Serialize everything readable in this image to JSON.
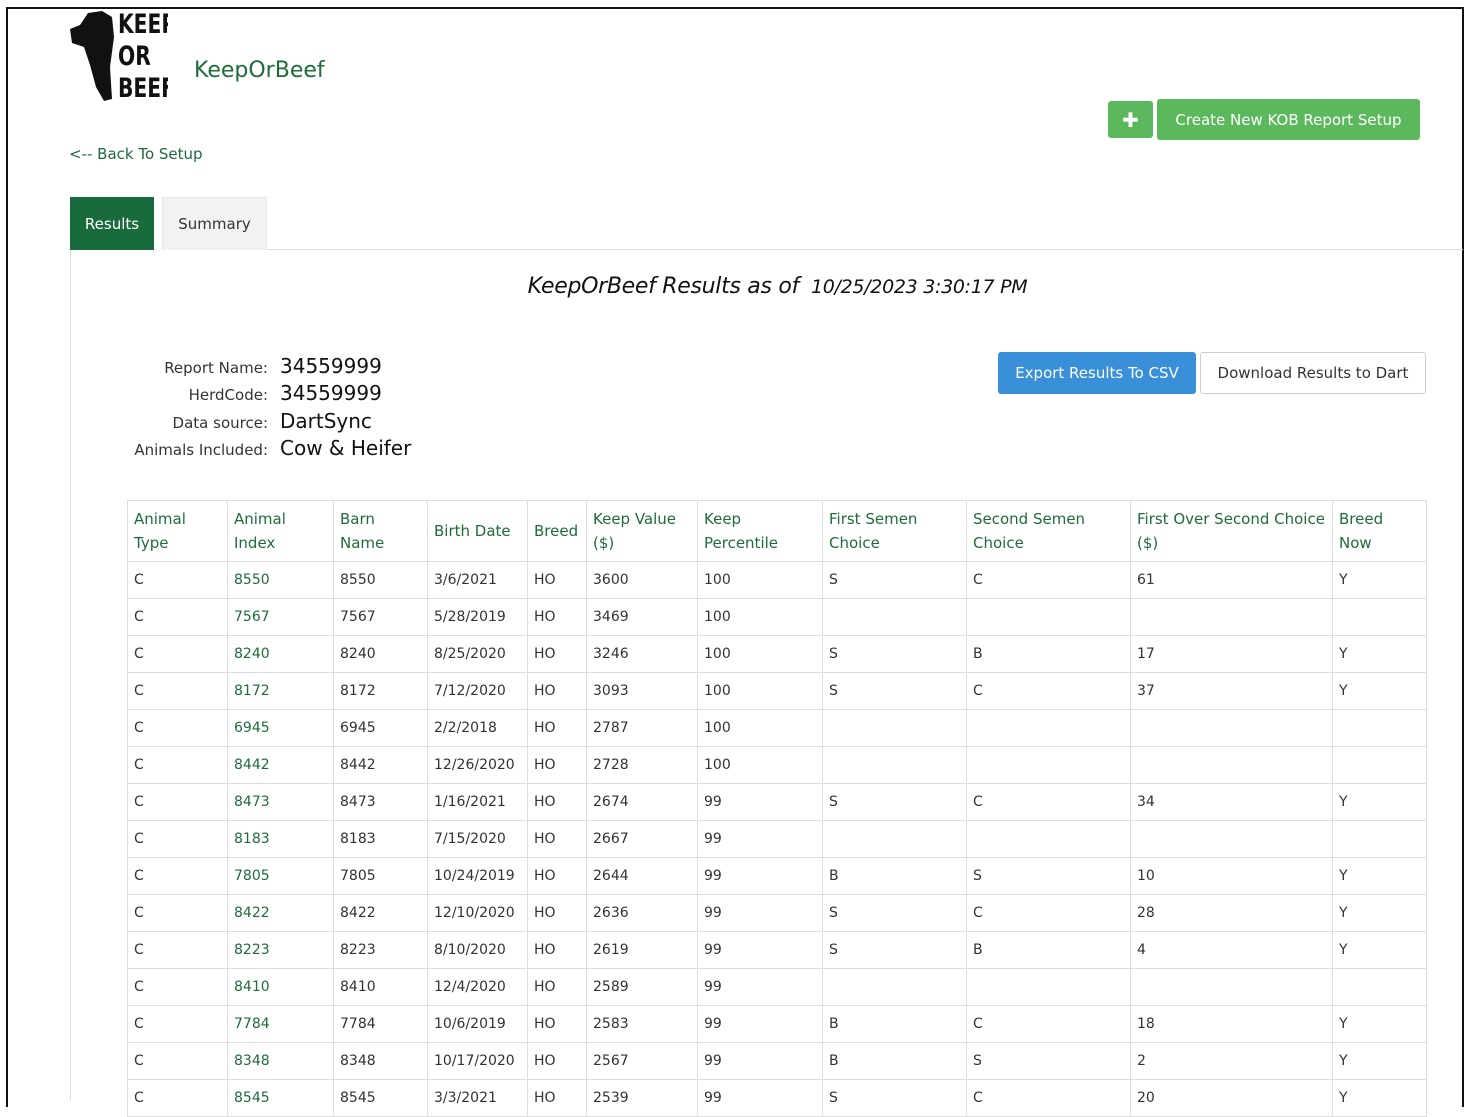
{
  "header": {
    "logo_text": [
      "KEEP",
      "OR",
      "BEEF"
    ],
    "brand": "KeepOrBeef",
    "back_link": "<-- Back To Setup",
    "plus_icon": "plus-icon",
    "create_button": "Create New KOB Report Setup"
  },
  "tabs": [
    {
      "label": "Results",
      "active": true
    },
    {
      "label": "Summary",
      "active": false
    }
  ],
  "results": {
    "title": "KeepOrBeef Results as of",
    "timestamp": "10/25/2023 3:30:17 PM"
  },
  "report_info": [
    {
      "label": "Report Name:",
      "value": "34559999"
    },
    {
      "label": "HerdCode:",
      "value": "34559999"
    },
    {
      "label": "Data source:",
      "value": "DartSync"
    },
    {
      "label": "Animals Included:",
      "value": "Cow & Heifer"
    }
  ],
  "actions": {
    "export_csv": "Export Results To CSV",
    "download_dart": "Download Results to Dart"
  },
  "colors": {
    "brand_green": "#1f6b3a",
    "button_green": "#5cb85c",
    "button_blue": "#3a8fd9"
  },
  "table": {
    "columns": [
      "Animal Type",
      "Animal Index",
      "Barn Name",
      "Birth Date",
      "Breed",
      "Keep Value ($)",
      "Keep Percentile",
      "First Semen Choice",
      "Second Semen Choice",
      "First Over Second Choice ($)",
      "Breed Now"
    ],
    "rows": [
      [
        "C",
        "8550",
        "8550",
        "3/6/2021",
        "HO",
        "3600",
        "100",
        "S",
        "C",
        "61",
        "Y"
      ],
      [
        "C",
        "7567",
        "7567",
        "5/28/2019",
        "HO",
        "3469",
        "100",
        "",
        "",
        "",
        ""
      ],
      [
        "C",
        "8240",
        "8240",
        "8/25/2020",
        "HO",
        "3246",
        "100",
        "S",
        "B",
        "17",
        "Y"
      ],
      [
        "C",
        "8172",
        "8172",
        "7/12/2020",
        "HO",
        "3093",
        "100",
        "S",
        "C",
        "37",
        "Y"
      ],
      [
        "C",
        "6945",
        "6945",
        "2/2/2018",
        "HO",
        "2787",
        "100",
        "",
        "",
        "",
        ""
      ],
      [
        "C",
        "8442",
        "8442",
        "12/26/2020",
        "HO",
        "2728",
        "100",
        "",
        "",
        "",
        ""
      ],
      [
        "C",
        "8473",
        "8473",
        "1/16/2021",
        "HO",
        "2674",
        "99",
        "S",
        "C",
        "34",
        "Y"
      ],
      [
        "C",
        "8183",
        "8183",
        "7/15/2020",
        "HO",
        "2667",
        "99",
        "",
        "",
        "",
        ""
      ],
      [
        "C",
        "7805",
        "7805",
        "10/24/2019",
        "HO",
        "2644",
        "99",
        "B",
        "S",
        "10",
        "Y"
      ],
      [
        "C",
        "8422",
        "8422",
        "12/10/2020",
        "HO",
        "2636",
        "99",
        "S",
        "C",
        "28",
        "Y"
      ],
      [
        "C",
        "8223",
        "8223",
        "8/10/2020",
        "HO",
        "2619",
        "99",
        "S",
        "B",
        "4",
        "Y"
      ],
      [
        "C",
        "8410",
        "8410",
        "12/4/2020",
        "HO",
        "2589",
        "99",
        "",
        "",
        "",
        ""
      ],
      [
        "C",
        "7784",
        "7784",
        "10/6/2019",
        "HO",
        "2583",
        "99",
        "B",
        "C",
        "18",
        "Y"
      ],
      [
        "C",
        "8348",
        "8348",
        "10/17/2020",
        "HO",
        "2567",
        "99",
        "B",
        "S",
        "2",
        "Y"
      ],
      [
        "C",
        "8545",
        "8545",
        "3/3/2021",
        "HO",
        "2539",
        "99",
        "S",
        "C",
        "20",
        "Y"
      ]
    ]
  }
}
